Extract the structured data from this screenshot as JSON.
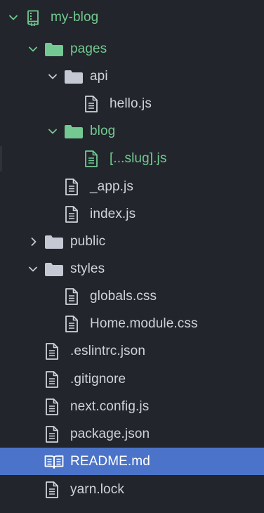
{
  "explorer": {
    "selected": "README.md",
    "colors": {
      "background": "#22252b",
      "selection": "#4b73c9",
      "text": "#cfd3dc",
      "modified": "#73c991",
      "folder": "#c4c9d4"
    },
    "items": [
      {
        "label": "my-blog",
        "type": "root",
        "expanded": true,
        "icon": "repo-icon"
      },
      {
        "label": "pages",
        "type": "folder",
        "expanded": true,
        "icon": "folder-icon"
      },
      {
        "label": "api",
        "type": "folder",
        "expanded": true,
        "icon": "folder-icon"
      },
      {
        "label": "hello.js",
        "type": "file",
        "icon": "file-icon"
      },
      {
        "label": "blog",
        "type": "folder",
        "expanded": true,
        "icon": "folder-icon"
      },
      {
        "label": "[...slug].js",
        "type": "file",
        "icon": "file-icon"
      },
      {
        "label": "_app.js",
        "type": "file",
        "icon": "file-icon"
      },
      {
        "label": "index.js",
        "type": "file",
        "icon": "file-icon"
      },
      {
        "label": "public",
        "type": "folder",
        "expanded": false,
        "icon": "folder-icon"
      },
      {
        "label": "styles",
        "type": "folder",
        "expanded": true,
        "icon": "folder-icon"
      },
      {
        "label": "globals.css",
        "type": "file",
        "icon": "file-icon"
      },
      {
        "label": "Home.module.css",
        "type": "file",
        "icon": "file-icon"
      },
      {
        "label": ".eslintrc.json",
        "type": "file",
        "icon": "file-icon"
      },
      {
        "label": ".gitignore",
        "type": "file",
        "icon": "file-icon"
      },
      {
        "label": "next.config.js",
        "type": "file",
        "icon": "file-icon"
      },
      {
        "label": "package.json",
        "type": "file",
        "icon": "file-icon"
      },
      {
        "label": "README.md",
        "type": "file",
        "icon": "book-icon"
      },
      {
        "label": "yarn.lock",
        "type": "file",
        "icon": "file-icon"
      }
    ]
  }
}
